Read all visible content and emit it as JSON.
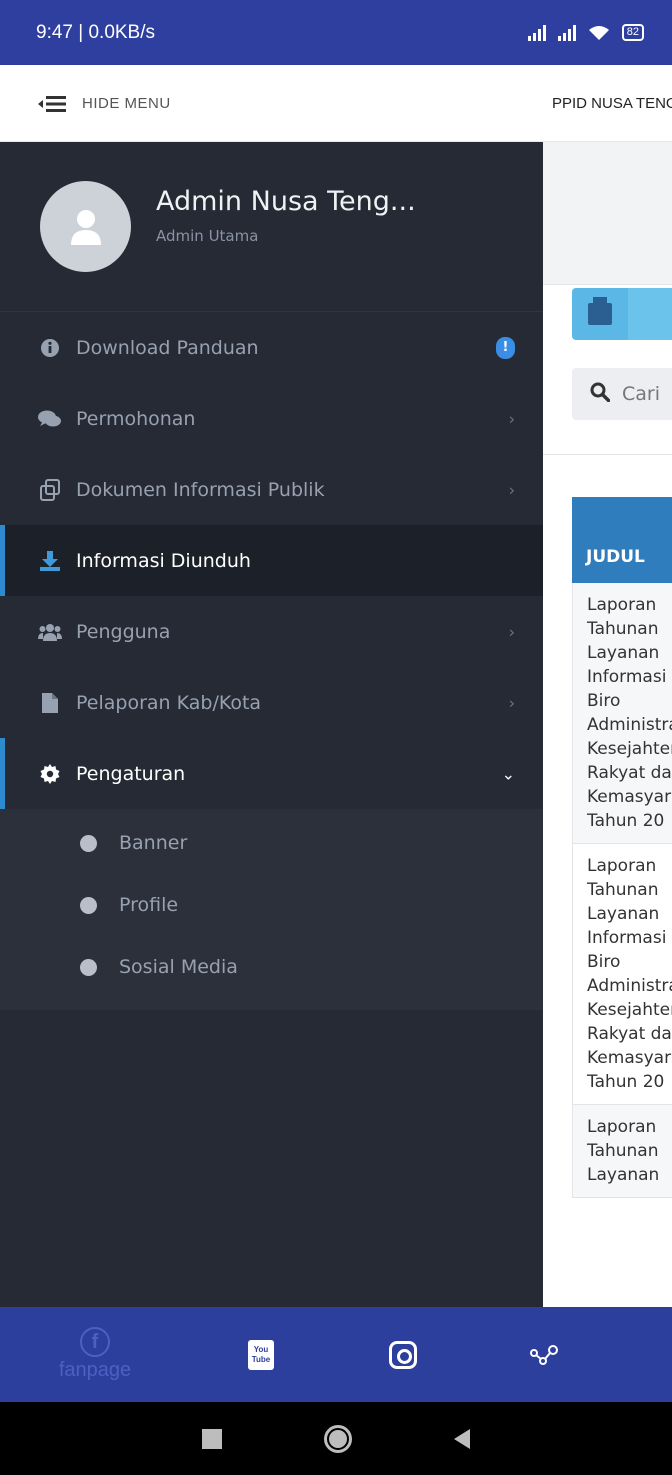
{
  "status_bar": {
    "time": "9:47 | 0.0KB/s",
    "battery": "82"
  },
  "topbar": {
    "hide_menu_label": "HIDE MENU",
    "brand": "PPID NUSA TENGGARA"
  },
  "profile": {
    "name": "Admin Nusa Teng...",
    "role": "Admin Utama"
  },
  "menu": {
    "items": [
      {
        "label": "Download Panduan",
        "icon": "info-circle-icon",
        "badge": "!"
      },
      {
        "label": "Permohonan",
        "icon": "comments-icon"
      },
      {
        "label": "Dokumen Informasi Publik",
        "icon": "copy-icon"
      },
      {
        "label": "Informasi Diunduh",
        "icon": "download-icon",
        "active": true
      },
      {
        "label": "Pengguna",
        "icon": "users-icon"
      },
      {
        "label": "Pelaporan Kab/Kota",
        "icon": "file-icon"
      },
      {
        "label": "Pengaturan",
        "icon": "gear-icon",
        "expanded": true
      }
    ],
    "submenu": [
      "Banner",
      "Profile",
      "Sosial Media"
    ]
  },
  "content": {
    "search_placeholder": "Cari",
    "table_header": "JUDUL",
    "rows": [
      [
        "Laporan",
        "Tahunan",
        "Layanan",
        "Informasi",
        "Biro",
        "Administrasi",
        "Kesejahteraan",
        "Rakyat dan",
        "Kemasyarakatan",
        "Tahun 20"
      ],
      [
        "Laporan",
        "Tahunan",
        "Layanan",
        "Informasi",
        "Biro",
        "Administrasi",
        "Kesejahteraan",
        "Rakyat dan",
        "Kemasyarakatan",
        "Tahun 20"
      ],
      [
        "Laporan",
        "Tahunan",
        "Layanan"
      ]
    ]
  },
  "social": {
    "facebook_label": "fanpage",
    "youtube_top": "You",
    "youtube_bottom": "Tube"
  },
  "colors": {
    "sidebar_bg": "#252a35",
    "accent": "#2e8bcf",
    "status_bar": "#2f3fa0",
    "social_bar": "#2d3f9c"
  }
}
